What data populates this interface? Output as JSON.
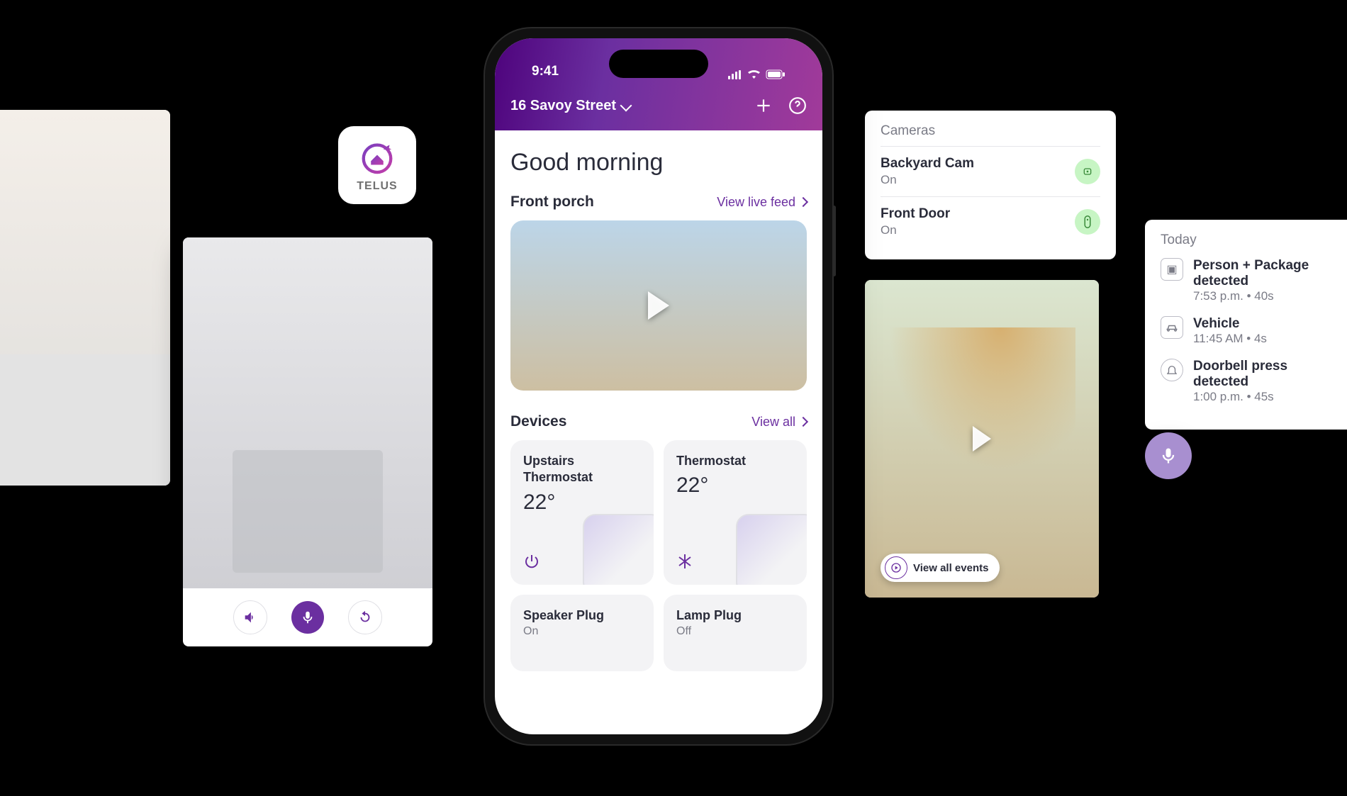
{
  "brand": "TELUS",
  "statusbar": {
    "time": "9:41"
  },
  "header": {
    "address": "16 Savoy Street"
  },
  "greeting": "Good morning",
  "front_porch": {
    "title": "Front porch",
    "live_link": "View live feed"
  },
  "devices_section": {
    "title": "Devices",
    "view_all": "View all"
  },
  "devices": [
    {
      "name": "Upstairs Thermostat",
      "value": "22°",
      "icon": "power"
    },
    {
      "name": "Thermostat",
      "value": "22°",
      "icon": "snowflake"
    },
    {
      "name": "Speaker Plug",
      "state": "On"
    },
    {
      "name": "Lamp Plug",
      "state": "Off"
    }
  ],
  "cameras_panel": {
    "title": "Cameras",
    "items": [
      {
        "name": "Backyard Cam",
        "state": "On"
      },
      {
        "name": "Front Door",
        "state": "On"
      }
    ]
  },
  "events_panel": {
    "title": "Today",
    "items": [
      {
        "title": "Person + Package detected",
        "sub": "7:53 p.m. • 40s",
        "icon": "clip"
      },
      {
        "title": "Vehicle",
        "sub": "11:45 AM • 4s",
        "icon": "car"
      },
      {
        "title": "Doorbell press detected",
        "sub": "1:00 p.m. • 45s",
        "icon": "bell"
      }
    ]
  },
  "backyard_chip": "View all events"
}
